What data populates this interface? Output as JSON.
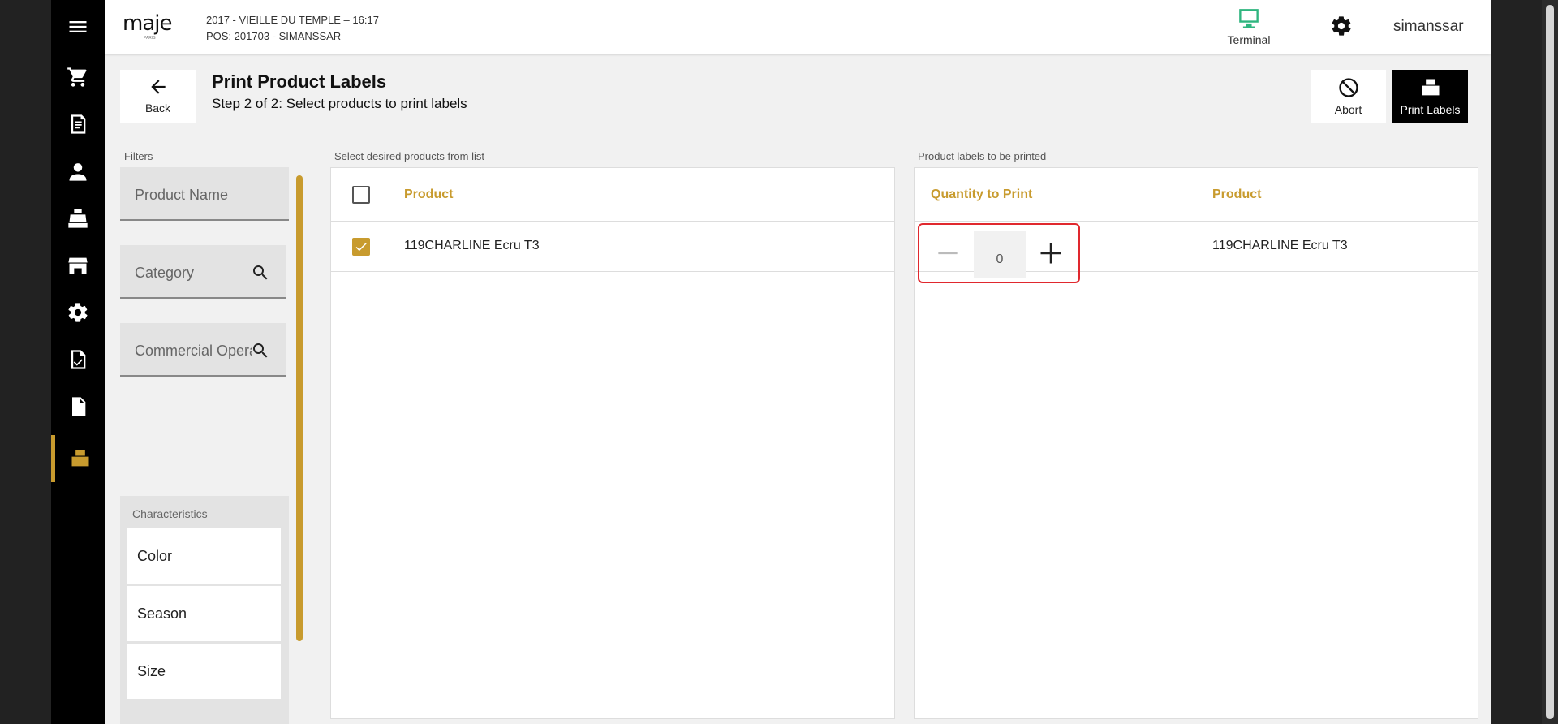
{
  "header": {
    "brand": "maje",
    "brand_sub": "PARIS",
    "store_line": "2017 - VIEILLE DU TEMPLE – 16:17",
    "pos_line": "POS: 201703 - SIMANSSAR",
    "terminal_label": "Terminal",
    "username": "simanssar"
  },
  "nav": {
    "items": [
      "menu-icon",
      "cart-icon",
      "receipt-icon",
      "person-icon",
      "cash-register-icon",
      "store-icon",
      "gear-icon",
      "report-icon",
      "document-icon",
      "label-printer-icon"
    ],
    "active": "label-printer-icon"
  },
  "page": {
    "back_label": "Back",
    "title": "Print Product Labels",
    "subtitle": "Step 2 of 2: Select products to print labels",
    "abort_label": "Abort",
    "print_label": "Print Labels"
  },
  "filters": {
    "section_label": "Filters",
    "product_name_placeholder": "Product Name",
    "category_placeholder": "Category",
    "commercial_op_placeholder": "Commercial Operation",
    "characteristics_title": "Characteristics",
    "characteristics": [
      "Color",
      "Season",
      "Size"
    ]
  },
  "product_list": {
    "section_label": "Select desired products from list",
    "header_product": "Product",
    "rows": [
      {
        "product": "119CHARLINE Ecru T3",
        "checked": true
      }
    ]
  },
  "labels_list": {
    "section_label": "Product labels to be printed",
    "header_quantity": "Quantity to Print",
    "header_product": "Product",
    "rows": [
      {
        "quantity": "0",
        "product": "119CHARLINE Ecru T3"
      }
    ]
  },
  "colors": {
    "accent": "#c89b2e",
    "terminal_green": "#2fb57f",
    "highlight_red": "#e0282e"
  }
}
